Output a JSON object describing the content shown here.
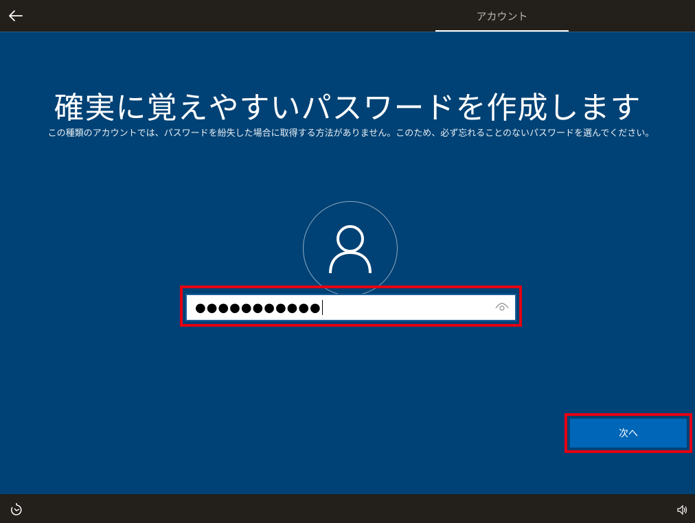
{
  "header": {
    "back_icon": "arrow-left-icon",
    "tab_label": "アカウント"
  },
  "main": {
    "title": "確実に覚えやすいパスワードを作成します",
    "subtitle": "この種類のアカウントでは、パスワードを紛失した場合に取得する方法がありません。このため、必ず忘れることのないパスワードを選んでください。",
    "avatar_icon": "user-icon",
    "password": {
      "masked_value": "●●●●●●●●●●●",
      "reveal_icon": "eye-icon"
    },
    "next_label": "次へ"
  },
  "footer": {
    "accessibility_icon": "ease-of-access-icon",
    "volume_icon": "volume-icon"
  },
  "colors": {
    "background": "#004275",
    "topbar": "#231f1a",
    "button": "#0067b8",
    "highlight": "#e60012"
  }
}
